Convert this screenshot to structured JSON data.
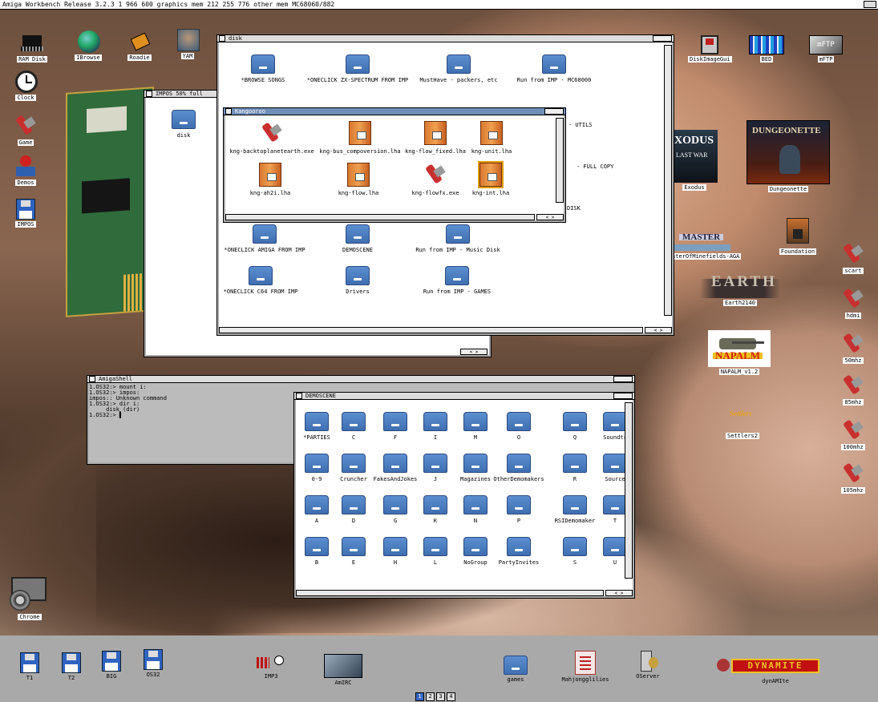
{
  "screen_title": "Amiga Workbench Release 3.2.3  1 966 600 graphics mem  212 255 776 other mem  MC68060/882",
  "desktop_left": [
    {
      "label": "RAM Disk",
      "icon": "ram-disk-icon"
    },
    {
      "label": "IBrowse",
      "icon": "globe-icon"
    },
    {
      "label": "Roadie",
      "icon": "roadie-icon"
    },
    {
      "label": "YAM",
      "icon": "yam-icon"
    },
    {
      "label": "Clock",
      "icon": "clock-icon"
    },
    {
      "label": "Game",
      "icon": "tool-icon"
    },
    {
      "label": "Demos",
      "icon": "joystick-icon"
    },
    {
      "label": "IMPOS",
      "icon": "floppy-icon"
    },
    {
      "label": "Chrome",
      "icon": "chrome-icon"
    }
  ],
  "desktop_right": [
    {
      "label": "DiskImageGui",
      "icon": "disk-image-icon"
    },
    {
      "label": "BED",
      "icon": "bed-icon"
    },
    {
      "label": "mFTP",
      "icon": "mftp-icon"
    },
    {
      "label": "Exodus",
      "icon": "game-cover-icon"
    },
    {
      "label": "Dungeonette",
      "icon": "game-cover-icon"
    },
    {
      "label": "MasterOfMinefields-AGA",
      "icon": "game-logo-icon"
    },
    {
      "label": "Foundation",
      "icon": "foundation-icon"
    },
    {
      "label": "Earth2140",
      "icon": "game-logo-icon"
    },
    {
      "label": "NAPALM_v1.2",
      "icon": "tank-icon"
    },
    {
      "label": "Settlers2",
      "icon": "game-logo-icon"
    },
    {
      "label": "scart",
      "icon": "tool-icon"
    },
    {
      "label": "hdmi",
      "icon": "tool-icon"
    },
    {
      "label": "50mhz",
      "icon": "tool-icon"
    },
    {
      "label": "85mhz",
      "icon": "tool-icon"
    },
    {
      "label": "100mhz",
      "icon": "tool-icon"
    },
    {
      "label": "105mhz",
      "icon": "tool-icon"
    }
  ],
  "cover_text": {
    "exodus": "XODUS",
    "exodus_sub": "LAST WAR",
    "dungeonette": "DUNGEONETTE",
    "master": "MASTER",
    "earth": "EARTH",
    "napalm": "NAPALM",
    "settlers": "Settlers"
  },
  "win_impos": {
    "title": "IMPOS  50% full",
    "items": [
      {
        "label": "disk"
      }
    ]
  },
  "win_disk": {
    "title": "disk",
    "items": [
      {
        "label": "*BROWSE SONGS"
      },
      {
        "label": "*ONECLICK ZX-SPECTRUM FROM IMP"
      },
      {
        "label": "MustHave - packers, etc"
      },
      {
        "label": "Run from IMP - MC68000"
      },
      {
        "label": "- UTILS"
      },
      {
        "label": "- FULL COPY"
      },
      {
        "label": "DISK"
      },
      {
        "label": "*ONECLICK AMIGA FROM IMP"
      },
      {
        "label": "DEMOSCENE"
      },
      {
        "label": "Run from IMP - Music Disk"
      },
      {
        "label": "*ONECLICK C64 FROM IMP"
      },
      {
        "label": "Drivers"
      },
      {
        "label": "Run from IMP - GAMES"
      }
    ]
  },
  "win_kangooroo": {
    "title": "Kangooroo",
    "items": [
      {
        "label": "kng-backtoplanetearth.exe",
        "icon": "tool-icon"
      },
      {
        "label": "kng-bus_compoversion.lha",
        "icon": "package-icon"
      },
      {
        "label": "kng-flow_fixed.lha",
        "icon": "package-icon"
      },
      {
        "label": "kng-unit.lha",
        "icon": "package-icon"
      },
      {
        "label": "kng-ah2i.lha",
        "icon": "package-icon"
      },
      {
        "label": "kng-flow.lha",
        "icon": "package-icon"
      },
      {
        "label": "kng-flowfx.exe",
        "icon": "tool-icon"
      },
      {
        "label": "kng-int.lha",
        "icon": "package-icon"
      }
    ]
  },
  "win_shell": {
    "title": "AmigaShell",
    "lines": [
      "1.OS32:> mount i:",
      "1.OS32:> impos:",
      "impos:: Unknown command",
      "1.OS32:> dir i:",
      "     disk (dir)",
      "1.OS32:> ▌"
    ]
  },
  "win_demoscene": {
    "title": "DEMOSCENE",
    "items": [
      "*PARTIES",
      "C",
      "F",
      "I",
      "M",
      "O",
      "Q",
      "Soundtr",
      "0-9",
      "Cruncher",
      "FakesAndJokes",
      "J",
      "Magazines",
      "OtherDemomakers",
      "R",
      "Source",
      "A",
      "D",
      "G",
      "K",
      "N",
      "P",
      "RSIDemomaker",
      "T",
      "B",
      "E",
      "H",
      "L",
      "NoGroup",
      "PartyInvites",
      "S",
      "U"
    ]
  },
  "dock": [
    {
      "label": "T1",
      "icon": "floppy-icon"
    },
    {
      "label": "T2",
      "icon": "floppy-icon"
    },
    {
      "label": "BIG",
      "icon": "floppy-icon"
    },
    {
      "label": "OS32",
      "icon": "floppy-icon"
    },
    {
      "label": "IMP3",
      "icon": "imp3-icon"
    },
    {
      "label": "AmIRC",
      "icon": "amirc-icon"
    },
    {
      "label": "games",
      "icon": "drawer-icon"
    },
    {
      "label": "Mahjongglilies",
      "icon": "mahjong-icon"
    },
    {
      "label": "OServer",
      "icon": "server-icon"
    },
    {
      "label": "dynAMIte",
      "icon": "dynamite-icon"
    }
  ],
  "dock_logo": "DYNAMITE",
  "pager": [
    "1",
    "2",
    "3",
    "4"
  ],
  "colors": {
    "window_bg": "#ffffff",
    "title_active": "#6f8fb8",
    "drawer_blue": "#4a7cc0",
    "dock": "#a9a9a9"
  }
}
